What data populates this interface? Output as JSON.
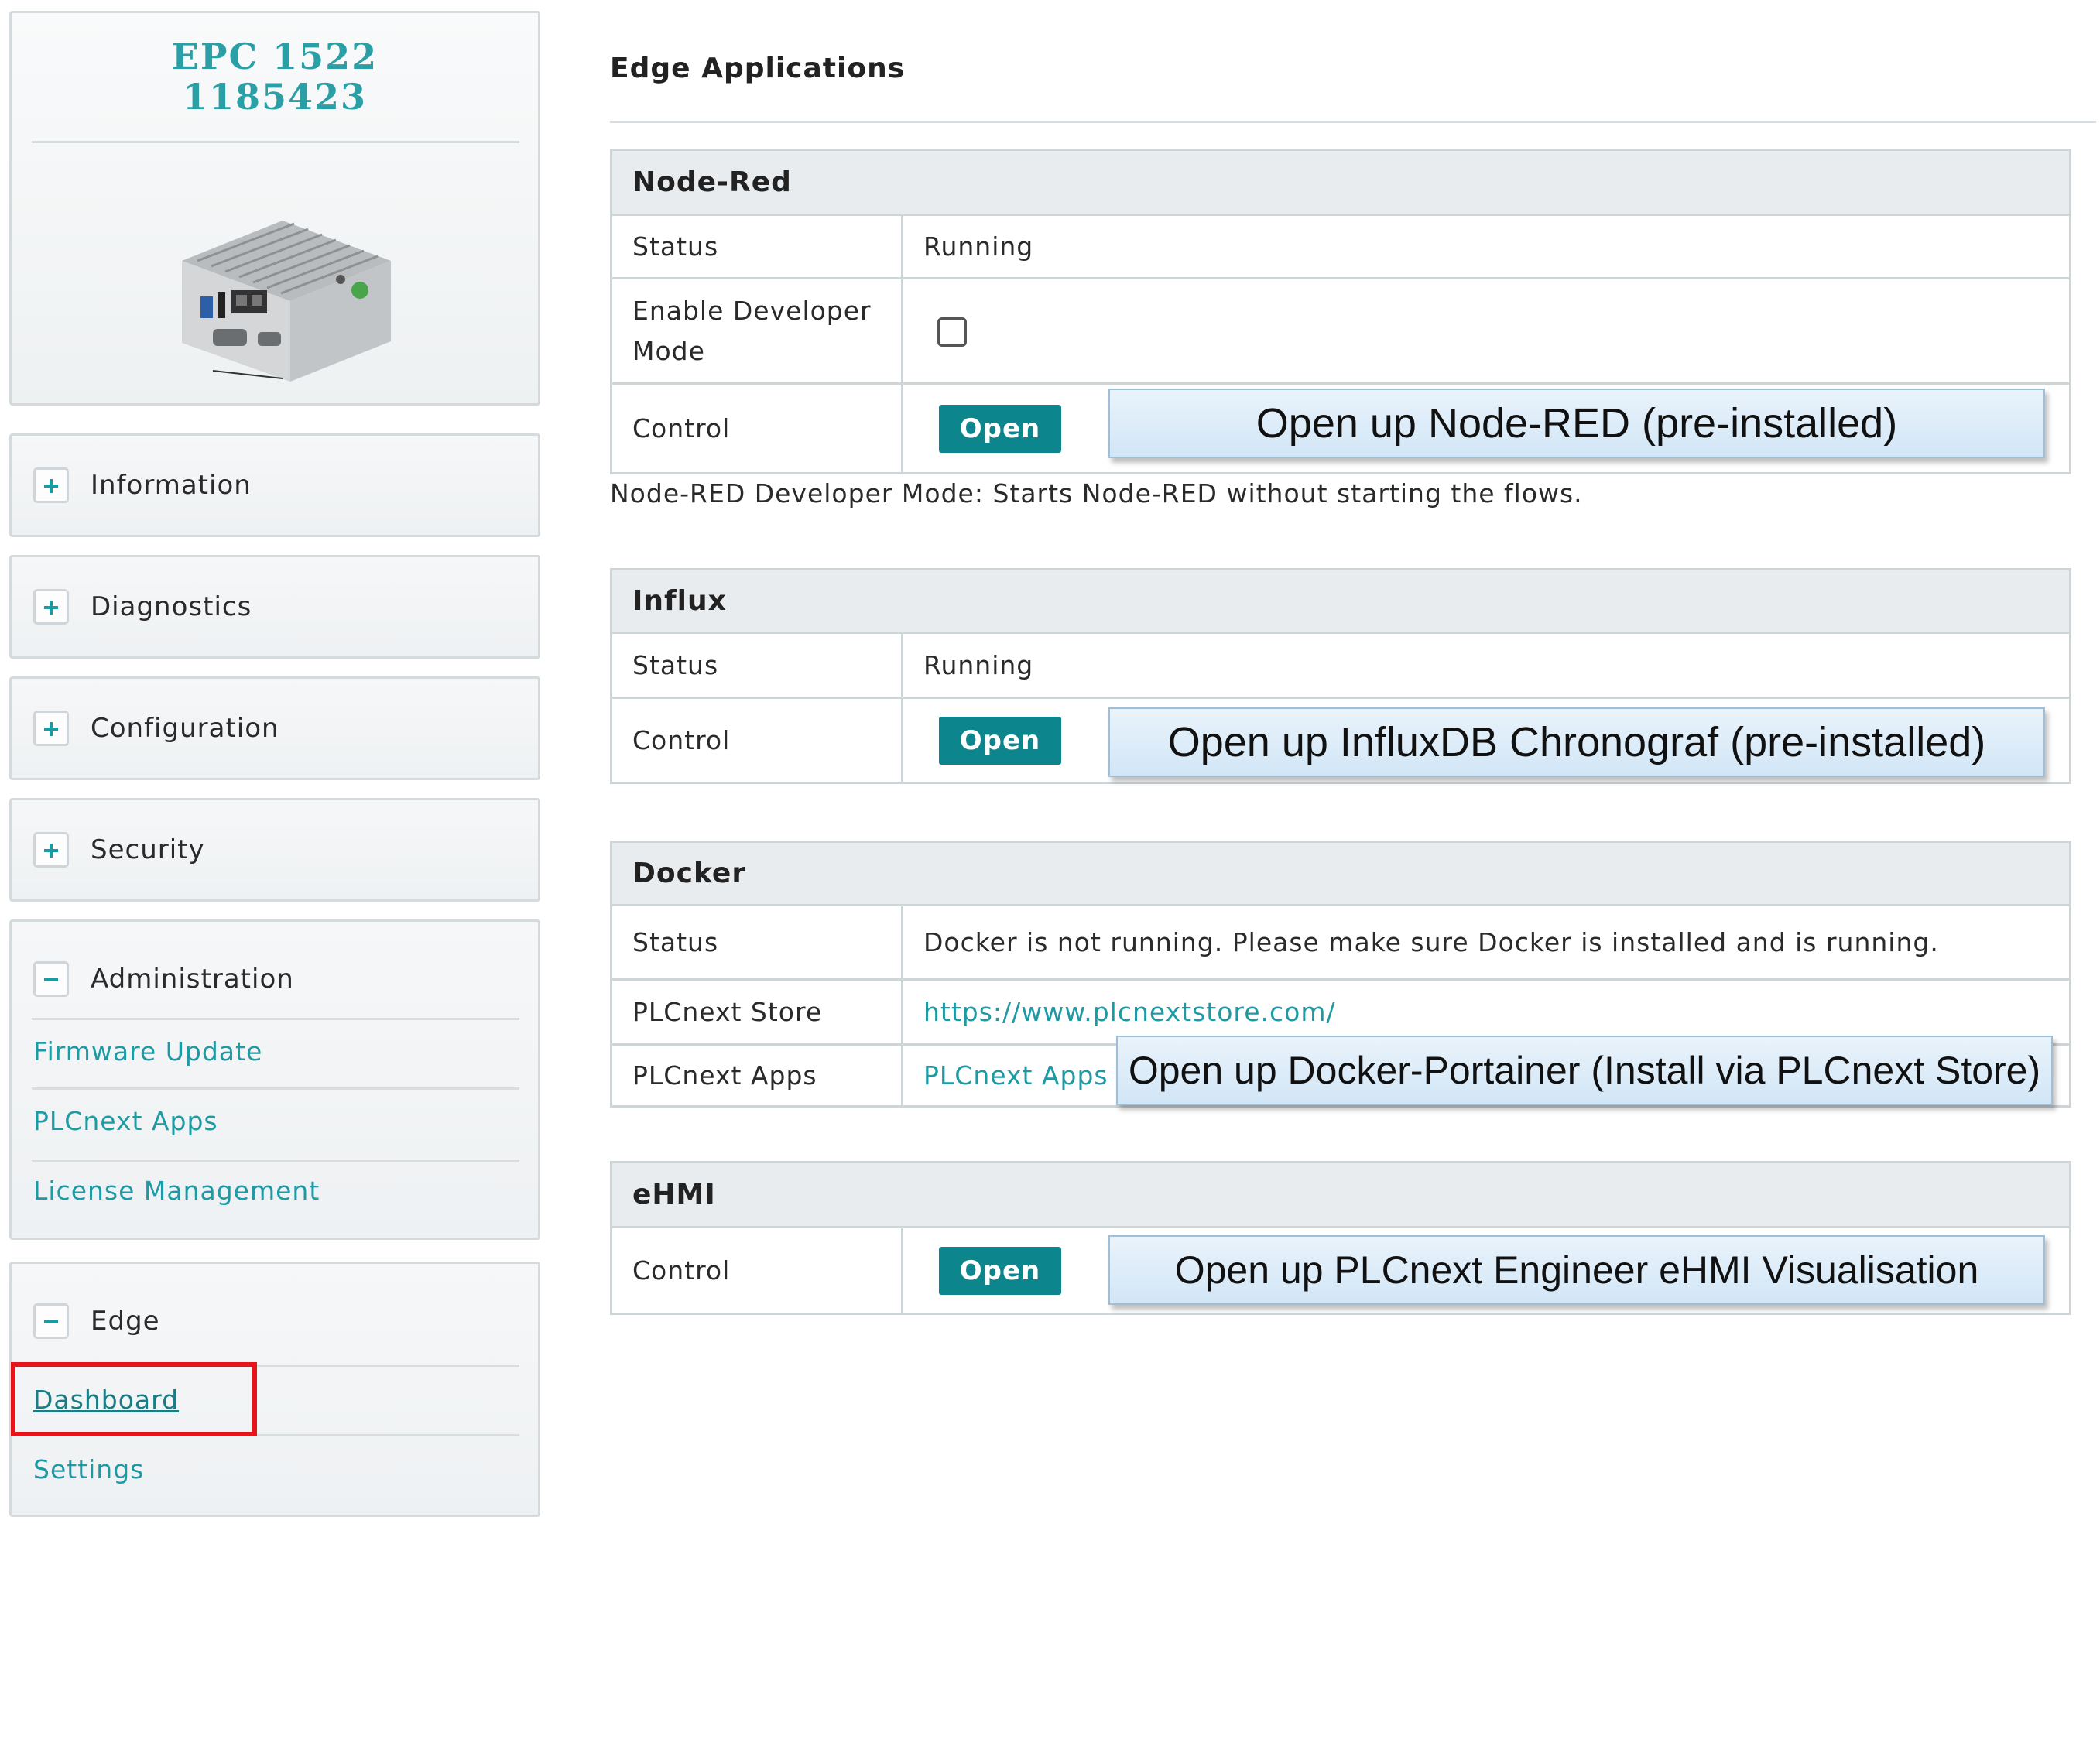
{
  "device": {
    "model": "EPC 1522",
    "order_number": "1185423",
    "image_icon": "industrial-pc-image"
  },
  "sidebar": {
    "sections": {
      "information": {
        "label": "Information",
        "toggle": "plus"
      },
      "diagnostics": {
        "label": "Diagnostics",
        "toggle": "plus"
      },
      "configuration": {
        "label": "Configuration",
        "toggle": "plus"
      },
      "security": {
        "label": "Security",
        "toggle": "plus"
      },
      "administration": {
        "label": "Administration",
        "toggle": "minus",
        "items": [
          "Firmware Update",
          "PLCnext Apps",
          "License Management"
        ]
      },
      "edge": {
        "label": "Edge",
        "toggle": "minus",
        "items": [
          "Dashboard",
          "Settings"
        ],
        "active_item": "Dashboard"
      }
    }
  },
  "main": {
    "title": "Edge Applications",
    "node_red": {
      "header": "Node-Red",
      "status_label": "Status",
      "status_value": "Running",
      "dev_mode_label": "Enable Developer Mode",
      "dev_mode_checked": false,
      "control_label": "Control",
      "open_label": "Open",
      "note": "Node-RED Developer Mode: Starts Node-RED without starting the flows."
    },
    "influx": {
      "header": "Influx",
      "status_label": "Status",
      "status_value": "Running",
      "control_label": "Control",
      "open_label": "Open"
    },
    "docker": {
      "header": "Docker",
      "status_label": "Status",
      "status_value": "Docker is not running. Please make sure Docker is installed and is running.",
      "store_label": "PLCnext Store",
      "store_link": "https://www.plcnextstore.com/",
      "apps_label": "PLCnext Apps",
      "apps_link": "PLCnext Apps"
    },
    "ehmi": {
      "header": "eHMI",
      "control_label": "Control",
      "open_label": "Open"
    }
  },
  "callouts": {
    "node_red": "Open up Node-RED (pre-installed)",
    "influx": "Open up InfluxDB Chronograf (pre-installed)",
    "docker": "Open up Docker-Portainer (Install via PLCnext Store)",
    "ehmi": "Open up PLCnext Engineer eHMI Visualisation"
  },
  "colors": {
    "accent": "#1d9aa3",
    "button": "#0d858d",
    "highlight": "#e8141b",
    "callout": "#d2e6f6"
  }
}
